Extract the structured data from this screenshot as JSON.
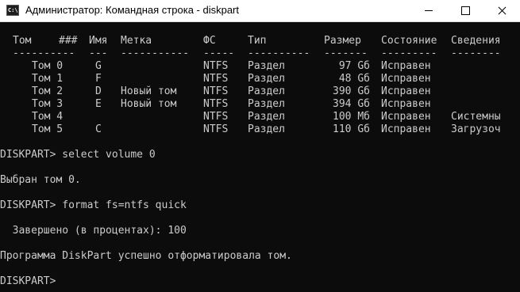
{
  "window": {
    "title": "Администратор: Командная строка - diskpart",
    "icon_text": "C:\\",
    "icon": "cmd-icon"
  },
  "table": {
    "headers": [
      "Том",
      "###",
      "Имя",
      "Метка",
      "ФС",
      "Тип",
      "Размер",
      "Состояние",
      "Сведения"
    ],
    "separators": [
      "----------",
      "---",
      "-----------",
      "-----",
      "----------",
      "-------",
      "---------",
      "--------"
    ],
    "rows": [
      [
        "Том 0",
        "G",
        "",
        "NTFS",
        "Раздел",
        "97 Gб",
        "Исправен",
        ""
      ],
      [
        "Том 1",
        "F",
        "",
        "NTFS",
        "Раздел",
        "48 Gб",
        "Исправен",
        ""
      ],
      [
        "Том 2",
        "D",
        "Новый том",
        "NTFS",
        "Раздел",
        "390 Gб",
        "Исправен",
        ""
      ],
      [
        "Том 3",
        "E",
        "Новый том",
        "NTFS",
        "Раздел",
        "394 Gб",
        "Исправен",
        ""
      ],
      [
        "Том 4",
        "",
        "",
        "NTFS",
        "Раздел",
        "100 Мб",
        "Исправен",
        "Системны"
      ],
      [
        "Том 5",
        "C",
        "",
        "NTFS",
        "Раздел",
        "110 Gб",
        "Исправен",
        "Загрузоч"
      ]
    ]
  },
  "lines": [
    "DISKPART> select volume 0",
    "Выбран том 0.",
    "DISKPART> format fs=ntfs quick",
    "  Завершено (в процентах): 100",
    "Программа DiskPart успешно отформатировала том.",
    "DISKPART>"
  ]
}
